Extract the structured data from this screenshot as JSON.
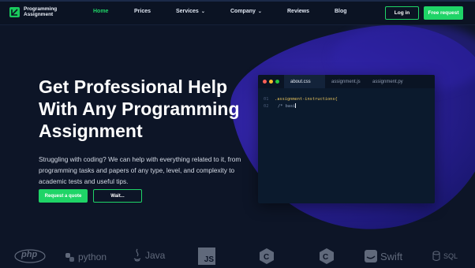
{
  "brand": {
    "line1": "Programming",
    "line2": "Assignment",
    "color": "#1fd467"
  },
  "nav": {
    "home": "Home",
    "prices": "Prices",
    "services": "Services",
    "company": "Company",
    "reviews": "Reviews",
    "blog": "Blog"
  },
  "auth": {
    "login": "Log in",
    "free_request": "Free request"
  },
  "hero": {
    "title": "Get Professional Help With Any Programming Assignment",
    "subtitle": "Struggling with coding? We can help with everything related to it, from programming tasks and papers of any type, level, and complexity to academic tests and useful tips.",
    "cta_primary": "Request a quote",
    "cta_secondary": "Wait..."
  },
  "editor": {
    "tabs": [
      "about.css",
      "assignment.js",
      "assignment.py"
    ],
    "lines": [
      {
        "num": "01",
        "text": ".assignment-instructions{"
      },
      {
        "num": "02",
        "text": "/* basi"
      }
    ]
  },
  "techs": {
    "php": "php",
    "python": "python",
    "java": "Java",
    "js": "JS",
    "swift": "Swift",
    "sql": "SQL"
  },
  "colors": {
    "bg": "#0d1527",
    "accent": "#1fd467",
    "blob": "#2a1f96"
  }
}
